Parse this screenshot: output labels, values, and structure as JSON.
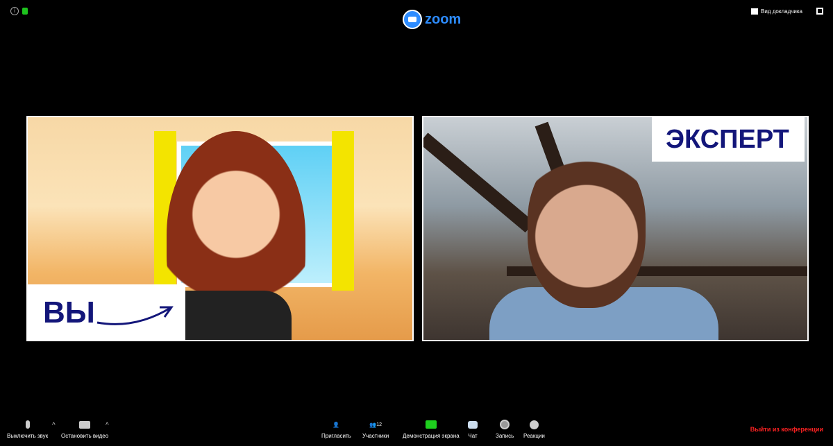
{
  "header": {
    "logo": "zoom",
    "view_label": "Вид докладчика"
  },
  "tiles": [
    {
      "label": "ВЫ"
    },
    {
      "label": "ЭКСПЕРТ"
    }
  ],
  "toolbar": {
    "mute": "Выключить звук",
    "video": "Остановить видео",
    "invite": "Пригласить",
    "participants": "Участники",
    "participants_count": "12",
    "share": "Демонстрация экрана",
    "chat": "Чат",
    "record": "Запись",
    "reactions": "Реакции",
    "leave": "Выйти из конференции"
  },
  "colors": {
    "brand": "#2d8cff",
    "share": "#1ed01e",
    "leave": "#ff2222",
    "label_text": "#13167a"
  }
}
